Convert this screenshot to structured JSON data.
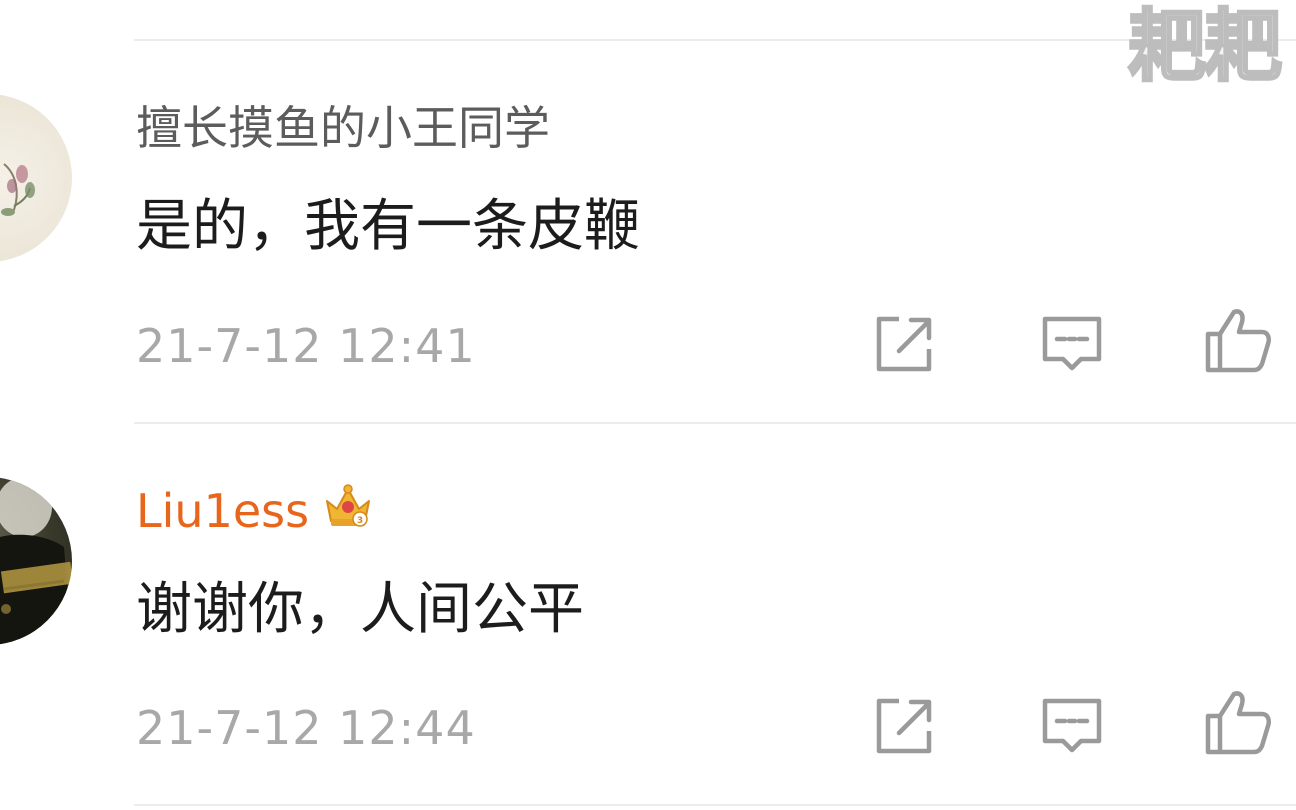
{
  "watermark": "耙耙",
  "comments": [
    {
      "username": "擅长摸鱼的小王同学",
      "text": "是的，我有一条皮鞭",
      "timestamp": "21-7-12 12:41",
      "vip": false
    },
    {
      "username": "Liu1ess",
      "text": "谢谢你，人间公平",
      "timestamp": "21-7-12 12:44",
      "vip": true
    }
  ],
  "colors": {
    "vip_name": "#e8651c",
    "username": "#5c5c5c",
    "timestamp": "#a8a8a8",
    "icon": "#9a9a9a"
  },
  "icons": [
    "share-icon",
    "reply-icon",
    "like-icon",
    "vip-crown-icon"
  ]
}
